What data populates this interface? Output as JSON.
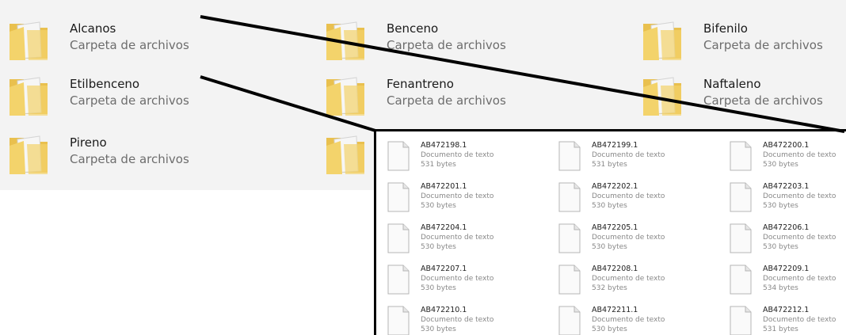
{
  "folder_type_label": "Carpeta de archivos",
  "folders": [
    {
      "name": "Alcanos"
    },
    {
      "name": "Benceno"
    },
    {
      "name": "Bifenilo"
    },
    {
      "name": "Etilbenceno"
    },
    {
      "name": "Fenantreno"
    },
    {
      "name": "Naftaleno"
    },
    {
      "name": "Pireno"
    },
    {
      "name": ""
    }
  ],
  "files": [
    {
      "name": "AB472198.1",
      "type": "Documento de texto",
      "size": "531 bytes"
    },
    {
      "name": "AB472199.1",
      "type": "Documento de texto",
      "size": "531 bytes"
    },
    {
      "name": "AB472200.1",
      "type": "Documento de texto",
      "size": "530 bytes"
    },
    {
      "name": "AB472201.1",
      "type": "Documento de texto",
      "size": "530 bytes"
    },
    {
      "name": "AB472202.1",
      "type": "Documento de texto",
      "size": "530 bytes"
    },
    {
      "name": "AB472203.1",
      "type": "Documento de texto",
      "size": "530 bytes"
    },
    {
      "name": "AB472204.1",
      "type": "Documento de texto",
      "size": "530 bytes"
    },
    {
      "name": "AB472205.1",
      "type": "Documento de texto",
      "size": "530 bytes"
    },
    {
      "name": "AB472206.1",
      "type": "Documento de texto",
      "size": "530 bytes"
    },
    {
      "name": "AB472207.1",
      "type": "Documento de texto",
      "size": "530 bytes"
    },
    {
      "name": "AB472208.1",
      "type": "Documento de texto",
      "size": "532 bytes"
    },
    {
      "name": "AB472209.1",
      "type": "Documento de texto",
      "size": "534 bytes"
    },
    {
      "name": "AB472210.1",
      "type": "Documento de texto",
      "size": "530 bytes"
    },
    {
      "name": "AB472211.1",
      "type": "Documento de texto",
      "size": "530 bytes"
    },
    {
      "name": "AB472212.1",
      "type": "Documento de texto",
      "size": "531 bytes"
    }
  ],
  "colors": {
    "folder_body": "#f3d36b",
    "folder_back": "#e9c04e",
    "folder_paper": "#f6f6f6",
    "callout_line": "#000000"
  }
}
